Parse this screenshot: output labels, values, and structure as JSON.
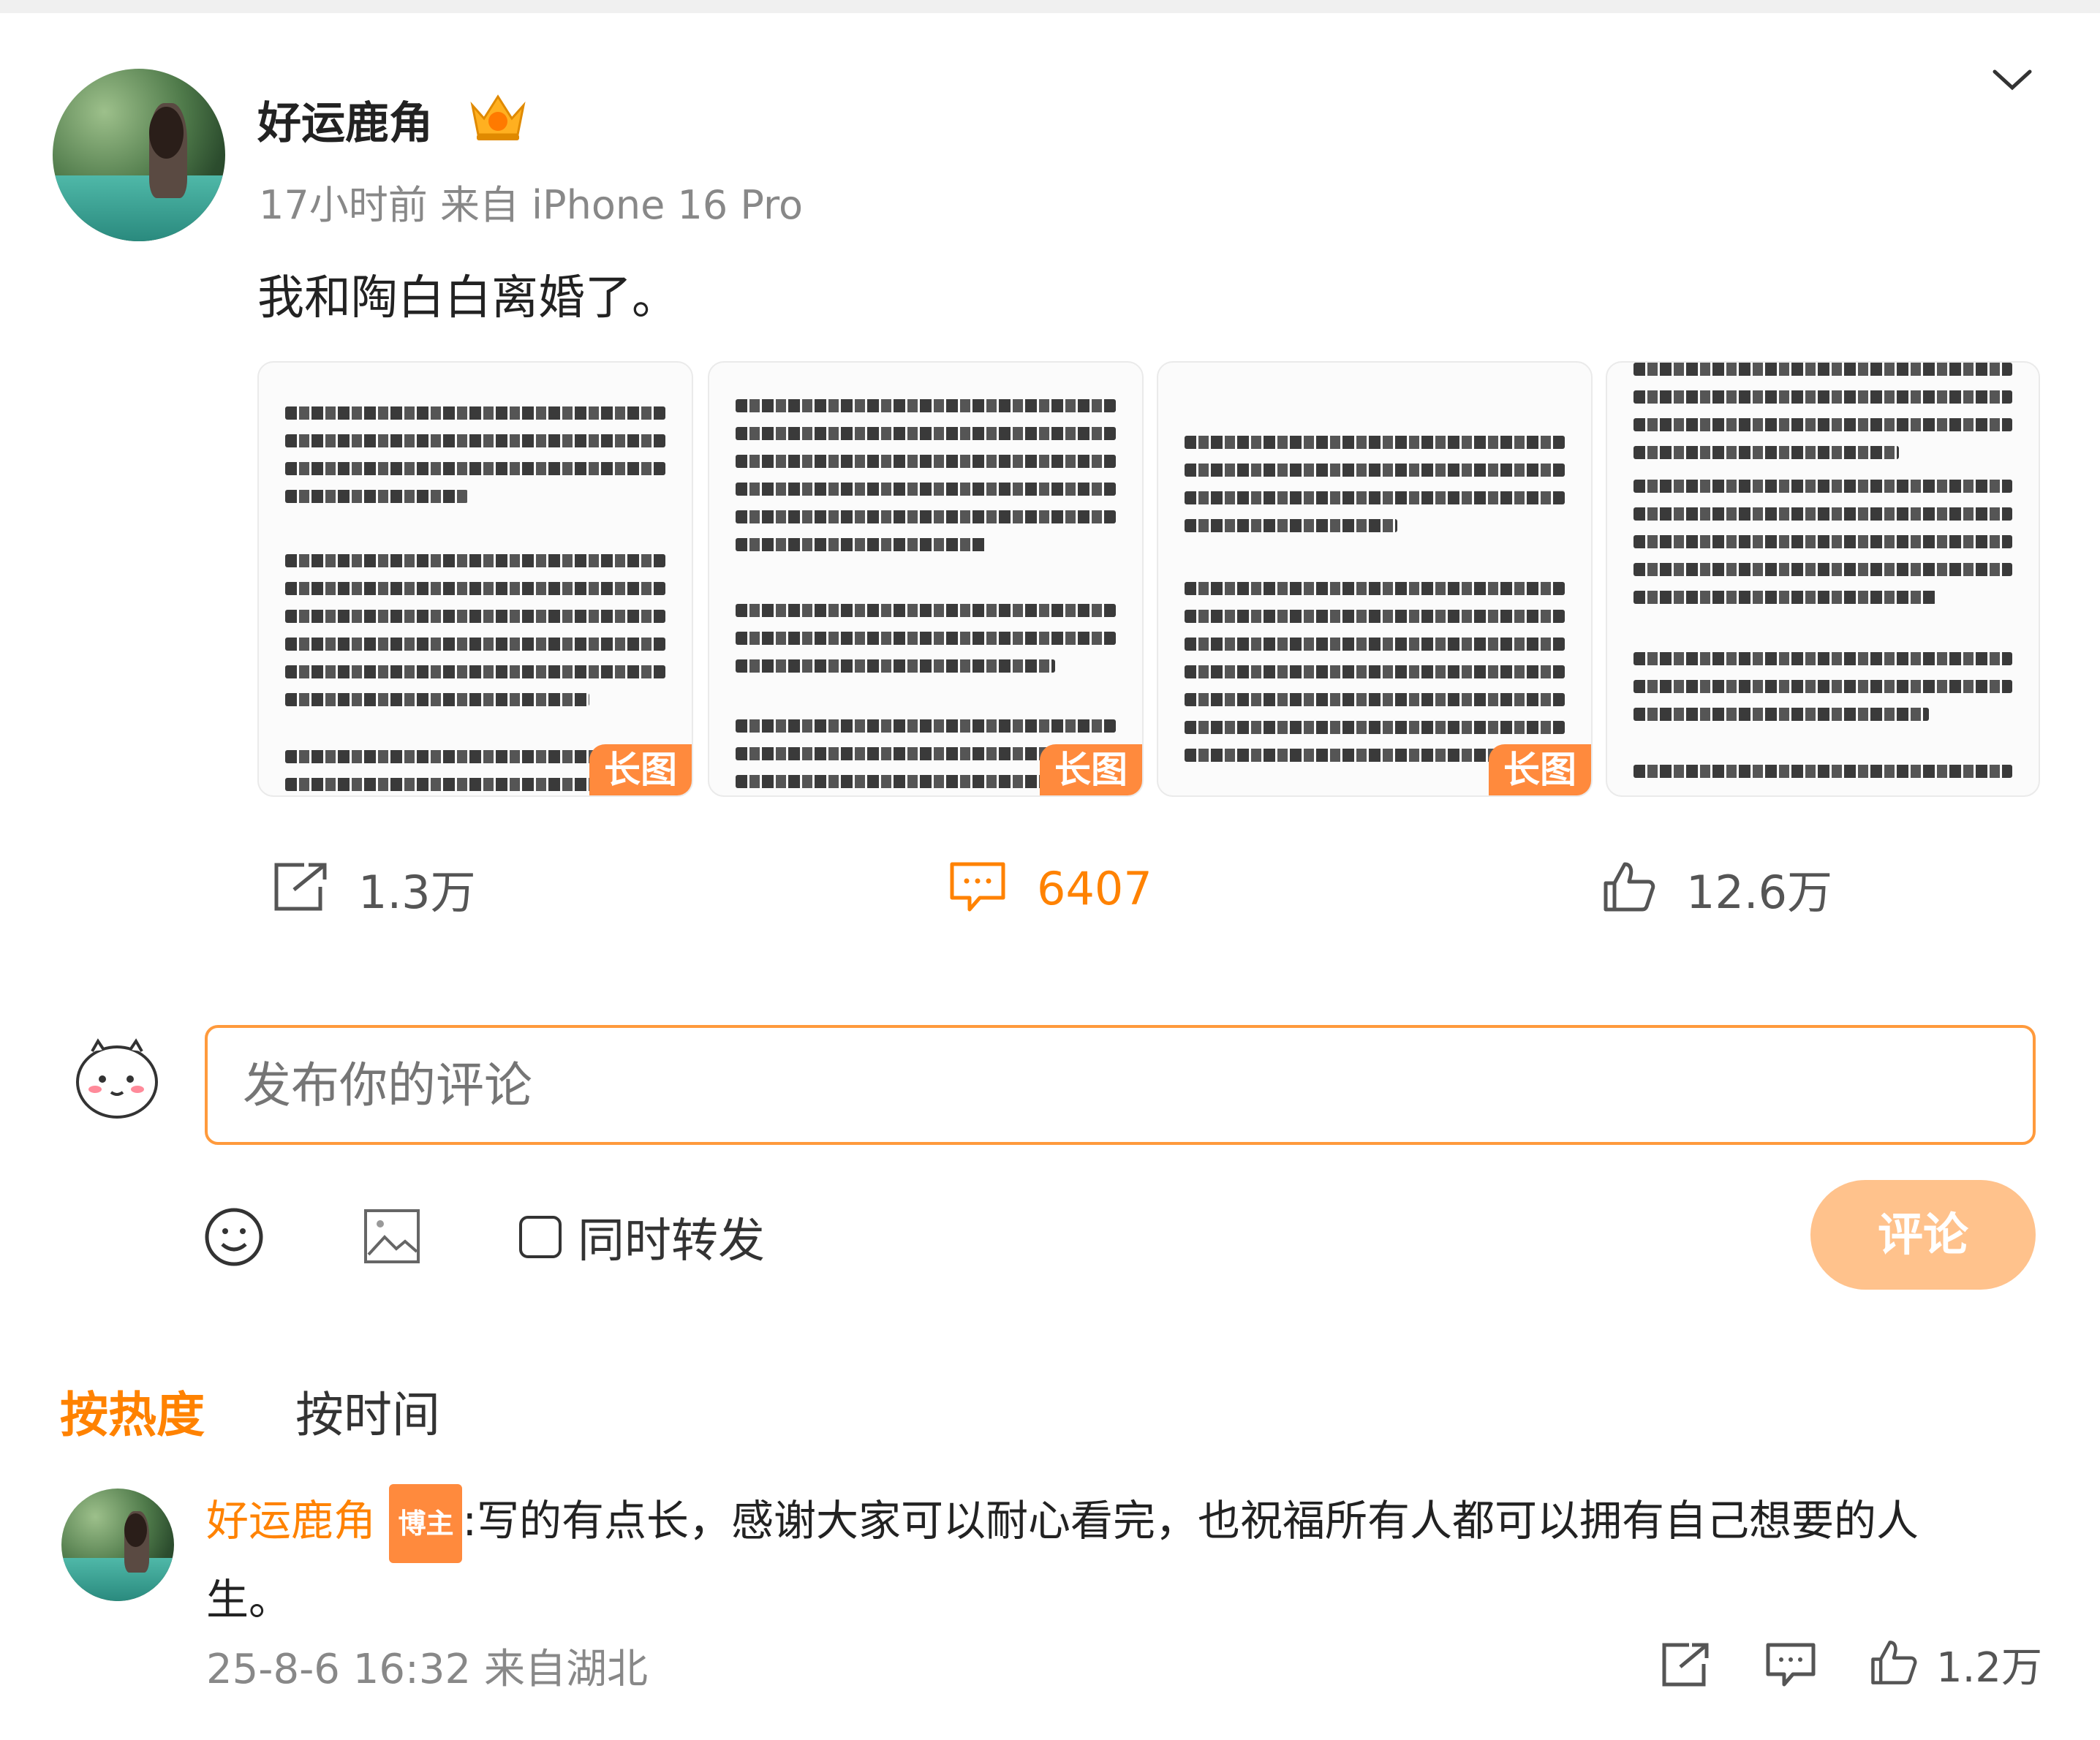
{
  "post": {
    "username": "好运鹿角",
    "time": "17小时前",
    "source": "来自 iPhone 16 Pro",
    "text": "我和陶白白离婚了。",
    "long_image_badge": "长图",
    "image_count": 4
  },
  "actions": {
    "repost_count": "1.3万",
    "comment_count": "6407",
    "like_count": "12.6万"
  },
  "composer": {
    "placeholder": "发布你的评论",
    "repost_checkbox_label": "同时转发",
    "submit_label": "评论"
  },
  "sort": {
    "hot": "按热度",
    "time": "按时间"
  },
  "comments": [
    {
      "username": "好运鹿角",
      "tag": "博主",
      "text_line1": ":写的有点长，感谢大家可以耐心看完，也祝福所有人都可以拥有自己想要的人",
      "text_line2": "生。",
      "date": "25-8-6 16:32",
      "location": "来自湖北",
      "like_count": "1.2万"
    }
  ],
  "colors": {
    "accent": "#ff8200",
    "input_border": "#ff9a3c",
    "submit_bg": "#ffc28c",
    "badge": "#ff8a3d"
  }
}
